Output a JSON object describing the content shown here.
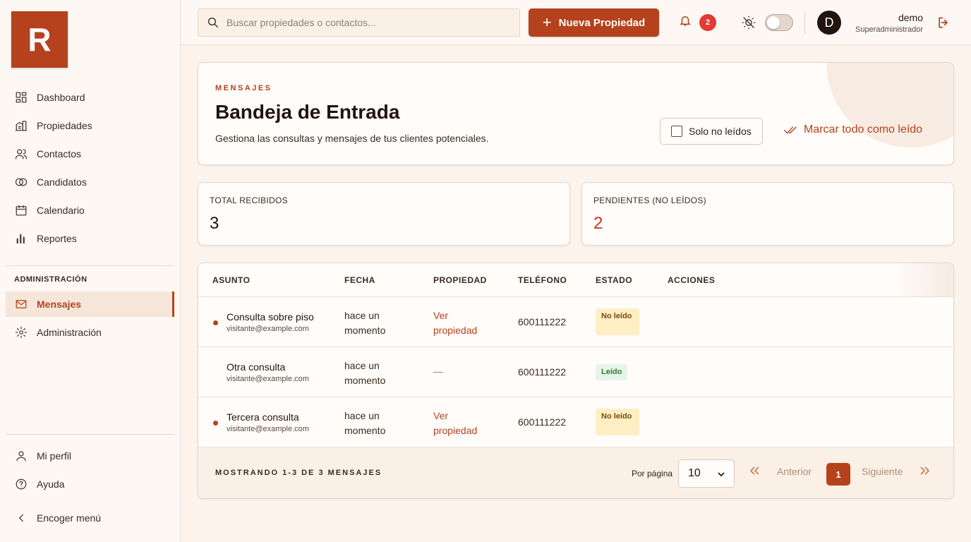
{
  "app": {
    "logo_letter": "R"
  },
  "sidebar": {
    "items": [
      {
        "label": "Dashboard",
        "icon": "dashboard-icon"
      },
      {
        "label": "Propiedades",
        "icon": "building-icon"
      },
      {
        "label": "Contactos",
        "icon": "contacts-icon"
      },
      {
        "label": "Candidatos",
        "icon": "candidates-icon"
      },
      {
        "label": "Calendario",
        "icon": "calendar-icon"
      },
      {
        "label": "Reportes",
        "icon": "reports-icon"
      }
    ],
    "section_label": "ADMINISTRACIÓN",
    "admin_items": [
      {
        "label": "Mensajes",
        "icon": "mail-icon",
        "active": true
      },
      {
        "label": "Administración",
        "icon": "gear-icon"
      }
    ],
    "bottom_items": [
      {
        "label": "Mi perfil",
        "icon": "user-icon"
      },
      {
        "label": "Ayuda",
        "icon": "help-icon"
      },
      {
        "label": "Encoger menú",
        "icon": "chevron-left-icon"
      }
    ]
  },
  "topbar": {
    "search_placeholder": "Buscar propiedades o contactos...",
    "new_button_label": "Nueva Propiedad",
    "notification_count": "2",
    "user_initial": "D",
    "user_name": "demo",
    "user_role": "Superadministrador"
  },
  "header": {
    "eyebrow": "MENSAJES",
    "title": "Bandeja de Entrada",
    "subtitle": "Gestiona las consultas y mensajes de tus clientes potenciales.",
    "unread_filter_label": "Solo no leídos",
    "mark_all_label": "Marcar todo como leído"
  },
  "stats": {
    "total_label": "TOTAL RECIBIDOS",
    "total_value": "3",
    "pending_label": "PENDIENTES (NO LEÍDOS)",
    "pending_value": "2"
  },
  "table": {
    "columns": [
      "ASUNTO",
      "FECHA",
      "PROPIEDAD",
      "TELÉFONO",
      "ESTADO",
      "ACCIONES"
    ],
    "rows": [
      {
        "subject": "Consulta sobre piso",
        "email": "visitante@example.com",
        "date": "hace un momento",
        "property": "Ver propiedad",
        "phone": "600111222",
        "status": "No leído",
        "unread": true
      },
      {
        "subject": "Otra consulta",
        "email": "visitante@example.com",
        "date": "hace un momento",
        "property": "—",
        "phone": "600111222",
        "status": "Leído",
        "unread": false
      },
      {
        "subject": "Tercera consulta",
        "email": "visitante@example.com",
        "date": "hace un momento",
        "property": "Ver propiedad",
        "phone": "600111222",
        "status": "No leído",
        "unread": true
      }
    ],
    "footer": {
      "showing": "MOSTRANDO 1-3 DE 3 MENSAJES",
      "per_page_label": "Por página",
      "per_page_value": "10",
      "prev_label": "Anterior",
      "current_page": "1",
      "next_label": "Siguiente"
    }
  },
  "colors": {
    "accent": "#b5421c",
    "danger": "#d32f2f",
    "background": "#fbf3ec"
  }
}
